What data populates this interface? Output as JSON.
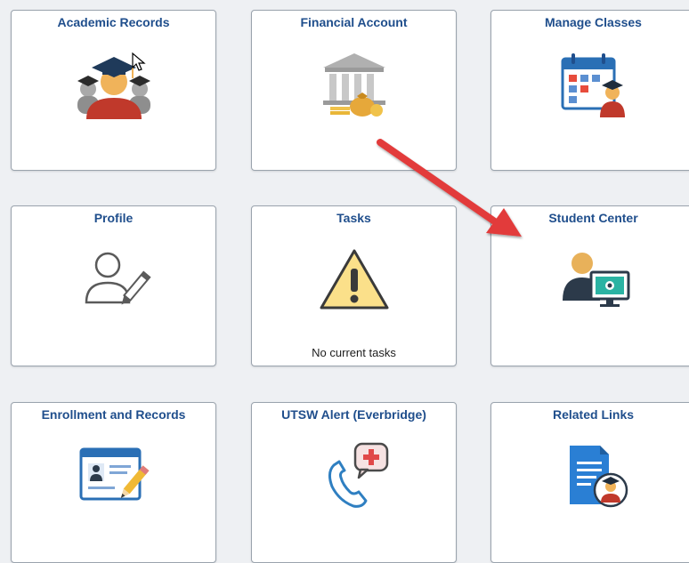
{
  "tiles": [
    {
      "title": "Academic Records",
      "icon": "graduates-icon"
    },
    {
      "title": "Financial Account",
      "icon": "bank-money-icon"
    },
    {
      "title": "Manage Classes",
      "icon": "calendar-student-icon"
    },
    {
      "title": "Profile",
      "icon": "user-edit-icon"
    },
    {
      "title": "Tasks",
      "icon": "warning-icon",
      "subtitle": "No current tasks"
    },
    {
      "title": "Student Center",
      "icon": "student-computer-icon"
    },
    {
      "title": "Enrollment and Records",
      "icon": "id-card-pencil-icon"
    },
    {
      "title": "UTSW Alert (Everbridge)",
      "icon": "phone-medical-icon"
    },
    {
      "title": "Related Links",
      "icon": "document-student-icon"
    }
  ],
  "colors": {
    "title": "#1f4e8c",
    "annotation_arrow": "#e23a3a",
    "tile_border": "#9aa3ad",
    "background": "#eef0f3"
  }
}
